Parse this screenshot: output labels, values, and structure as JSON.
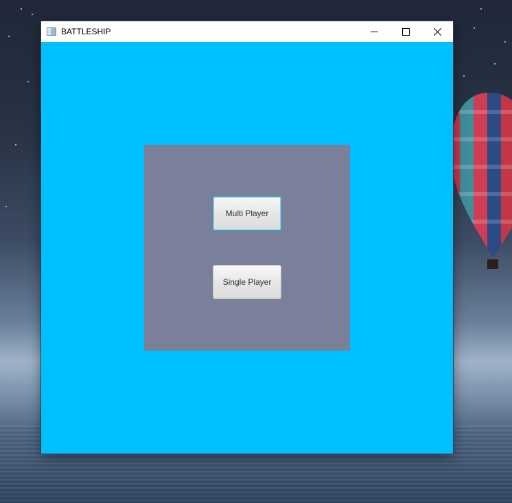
{
  "window": {
    "title": "BATTLESHIP",
    "controls": {
      "minimize_icon": "minimize-icon",
      "maximize_icon": "maximize-icon",
      "close_icon": "close-icon"
    }
  },
  "menu": {
    "buttons": [
      {
        "label": "Multi Player",
        "focused": true
      },
      {
        "label": "Single Player",
        "focused": false
      }
    ]
  },
  "colors": {
    "window_background": "#00bfff",
    "panel_background": "#7a7f9a",
    "focus_border": "#39a8d8"
  }
}
